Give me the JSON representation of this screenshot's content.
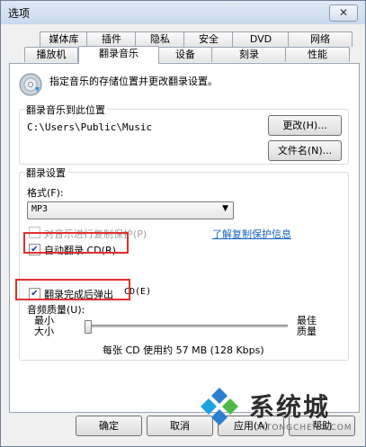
{
  "window": {
    "title": "选项",
    "close_glyph": "✕"
  },
  "tabs_row1": [
    "媒体库",
    "插件",
    "隐私",
    "安全",
    "DVD",
    "网络"
  ],
  "tabs_row2": [
    "播放机",
    "翻录音乐",
    "设备",
    "刻录",
    "性能"
  ],
  "header": {
    "description": "指定音乐的存储位置并更改翻录设置。"
  },
  "location": {
    "group_label": "翻录音乐到此位置",
    "path": "C:\\Users\\Public\\Music",
    "change_button": "更改(H)...",
    "filename_button": "文件名(N)..."
  },
  "settings": {
    "group_label": "翻录设置",
    "format_label": "格式(F):",
    "format_value": "MP3",
    "copy_protect_label": "对音乐进行复制保护(P)",
    "copy_protect_link": "了解复制保护信息",
    "auto_rip_label": "自动翻录 CD(R)",
    "eject_label": "翻录完成后弹出",
    "eject_suffix": "CD(E)",
    "quality_label": "音频质量(U):",
    "min_label": "最小\n大小",
    "max_label": "最佳\n质量",
    "quality_info": "每张 CD 使用约 57 MB (128 Kbps)",
    "quality_level": 0.0
  },
  "footer": {
    "ok_button": "确定",
    "cancel_button": "取消",
    "apply_button": "应用(A)",
    "help_button": "帮助"
  },
  "watermark": {
    "text": "系统城",
    "subtext": "XITONGCHENG.COM"
  }
}
